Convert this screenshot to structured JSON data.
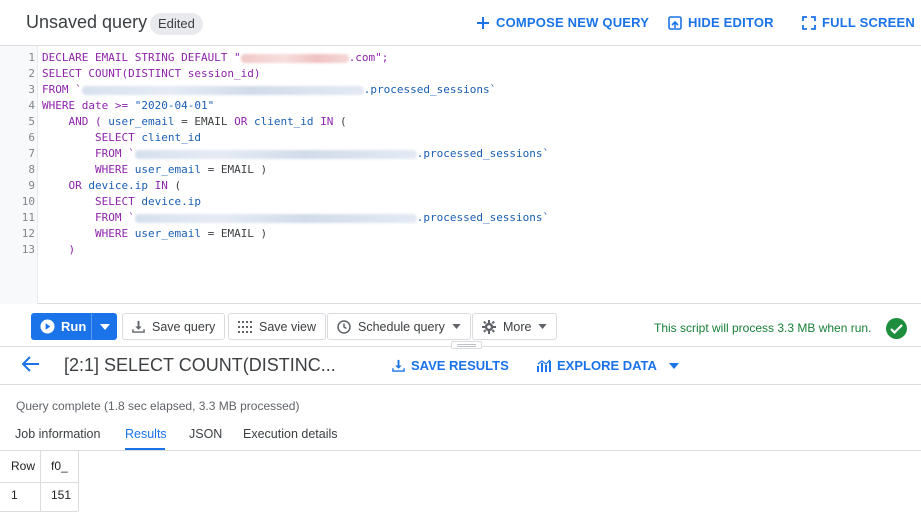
{
  "header": {
    "title": "Unsaved query",
    "badge": "Edited",
    "compose_label": "COMPOSE NEW QUERY",
    "hide_editor_label": "HIDE EDITOR",
    "full_screen_label": "FULL SCREEN"
  },
  "editor": {
    "lines": [
      {
        "n": "1"
      },
      {
        "n": "2"
      },
      {
        "n": "3"
      },
      {
        "n": "4"
      },
      {
        "n": "5"
      },
      {
        "n": "6"
      },
      {
        "n": "7"
      },
      {
        "n": "8"
      },
      {
        "n": "9"
      },
      {
        "n": "10"
      },
      {
        "n": "11"
      },
      {
        "n": "12"
      },
      {
        "n": "13"
      }
    ],
    "t": {
      "l1a": "DECLARE EMAIL STRING DEFAULT \"",
      "l1b": ".com\";",
      "l2": "SELECT COUNT(DISTINCT session_id)",
      "l3a": "FROM `",
      "l3b": ".processed_sessions`",
      "l4a": "WHERE date >= ",
      "l4b": "\"2020-04-01\"",
      "l5a": "    AND ( ",
      "l5b": "user_email",
      "l5c": " = EMAIL ",
      "l5d": "OR",
      "l5e": " client_id ",
      "l5f": "IN",
      "l5g": " (",
      "l6a": "        SELECT",
      "l6b": " client_id",
      "l7a": "        FROM `",
      "l7b": ".processed_sessions`",
      "l8a": "        WHERE",
      "l8b": " user_email",
      "l8c": " = EMAIL )",
      "l9a": "    OR",
      "l9b": " device.ip ",
      "l9c": "IN",
      "l9d": " (",
      "l10a": "        SELECT",
      "l10b": " device.ip",
      "l11a": "        FROM `",
      "l11b": ".processed_sessions`",
      "l12a": "        WHERE",
      "l12b": " user_email",
      "l12c": " = EMAIL )",
      "l13": "    )"
    }
  },
  "toolbar": {
    "run_label": "Run",
    "save_query_label": "Save query",
    "save_view_label": "Save view",
    "schedule_label": "Schedule query",
    "more_label": "More",
    "status": "This script will process 3.3 MB when run."
  },
  "results": {
    "title": "[2:1] SELECT COUNT(DISTINC...",
    "save_results_label": "SAVE RESULTS",
    "explore_label": "EXPLORE DATA",
    "query_status": "Query complete (1.8 sec elapsed, 3.3 MB processed)",
    "tabs": [
      {
        "label": "Job information"
      },
      {
        "label": "Results"
      },
      {
        "label": "JSON"
      },
      {
        "label": "Execution details"
      }
    ],
    "columns": [
      "Row",
      "f0_"
    ],
    "rows": [
      [
        "1",
        "151"
      ]
    ]
  },
  "colors": {
    "accent": "#1a73e8",
    "success": "#1e8e3e",
    "keyword": "#8e24aa"
  }
}
